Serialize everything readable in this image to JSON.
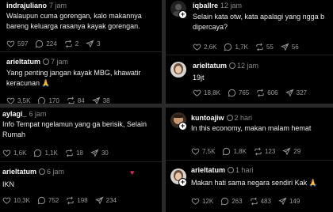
{
  "tl": {
    "post1": {
      "user": "indrajuliano",
      "time": "7 jam",
      "lines": [
        "Walaupun cuma gorengan, kalo makannya",
        "bareng keluarga rasanya kayak gorengan."
      ],
      "likes": "597",
      "replies": "224",
      "reposts": "2",
      "shares": "3"
    },
    "post2": {
      "user": "arieltatum",
      "time": "7 jam",
      "lines": [
        "Yang penting jangan kayak MBG, khawatir",
        "keracunan"
      ],
      "likes": "3,5K",
      "replies": "170",
      "reposts": "84",
      "shares": "38"
    }
  },
  "tr": {
    "post1": {
      "user": "iqballre",
      "time": "12 jam",
      "lines": [
        "Selain kata otw, kata apalagi yang ngga b",
        "dipercaya?"
      ],
      "likes": "2,6K",
      "replies": "1,7K",
      "reposts": "55",
      "shares": "56"
    },
    "post2": {
      "user": "arieltatum",
      "time": "12 jam",
      "lines": [
        "19jt"
      ],
      "likes": "18,8K",
      "replies": "765",
      "reposts": "606",
      "shares": "327"
    }
  },
  "bl": {
    "post1": {
      "user": "aylagi_",
      "time": "6 jam",
      "lines": [
        "Info Tempat ngelamun yang ga berisik, Selain",
        "Rumah"
      ],
      "likes": "1,6K",
      "replies": "1,1K",
      "reposts": "18",
      "shares": "30"
    },
    "post2": {
      "user": "arieltatum",
      "time": "6 jam",
      "lines": [
        "IKN"
      ],
      "likes": "10,3K",
      "replies": "752",
      "reposts": "198",
      "shares": "234"
    }
  },
  "br": {
    "post1": {
      "user": "kuntoajiw",
      "time": "2 hari",
      "lines": [
        "In this economy, makan malam hemat"
      ],
      "likes": "7,5K",
      "replies": "1,8K",
      "reposts": "123",
      "shares": "29"
    },
    "post2": {
      "user": "arieltatum",
      "time": "1 hari",
      "lines": [
        "Makan hati sama negara sendiri Kak"
      ],
      "likes": "12K",
      "replies": "263",
      "reposts": "483",
      "shares": "149"
    }
  },
  "more_label": "···",
  "colors": {
    "background": "#000000",
    "text": "#f3f3f3",
    "muted": "#8a8a8a",
    "verified": "#1d9bf0"
  }
}
